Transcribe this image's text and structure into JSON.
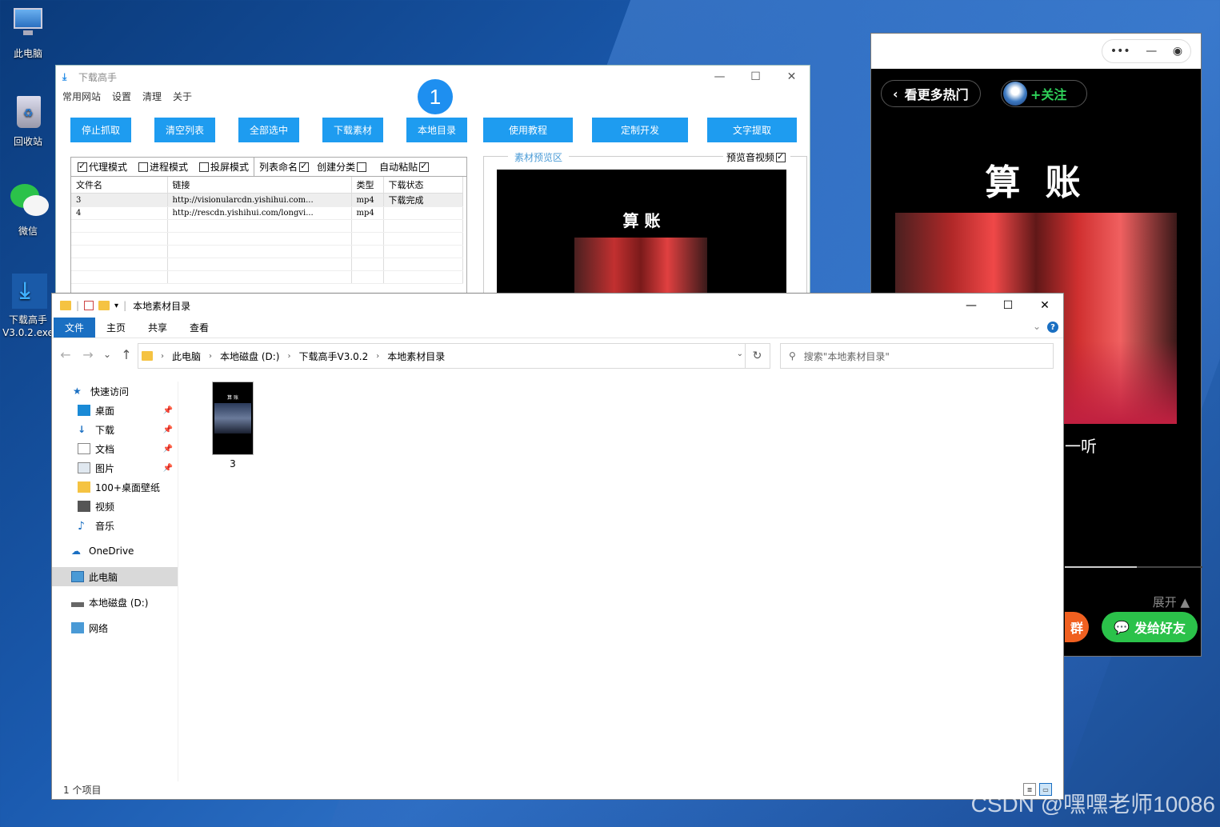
{
  "desktop": {
    "icons": [
      {
        "label": "此电脑"
      },
      {
        "label": "回收站"
      },
      {
        "label": "微信"
      },
      {
        "label": "下载高手\nV3.0.2.exe"
      }
    ]
  },
  "downloader": {
    "title": "下载高手",
    "menu": [
      "常用网站",
      "设置",
      "清理",
      "关于"
    ],
    "buttons": [
      "停止抓取",
      "清空列表",
      "全部选中",
      "下载素材",
      "本地目录",
      "使用教程",
      "定制开发",
      "文字提取"
    ],
    "badge": "1",
    "options": [
      {
        "label": "代理模式",
        "checked": true
      },
      {
        "label": "进程模式",
        "checked": false
      },
      {
        "label": "投屏模式",
        "checked": false
      },
      {
        "label": "列表命名",
        "checked": true
      },
      {
        "label": "创建分类",
        "checked": false
      },
      {
        "label": "自动粘贴",
        "checked": true
      }
    ],
    "table": {
      "headers": [
        "文件名",
        "链接",
        "类型",
        "下载状态"
      ],
      "rows": [
        [
          "3",
          "http://visionularcdn.yishihui.com...",
          "mp4",
          "下载完成"
        ],
        [
          "4",
          "http://rescdn.yishihui.com/longvi...",
          "mp4",
          ""
        ]
      ]
    },
    "preview": {
      "label": "素材预览区",
      "check_label": "预览音视频",
      "video_title": "算 账"
    }
  },
  "phone": {
    "back_label": "看更多热门",
    "follow_label": "+关注",
    "title": "算 账",
    "caption": "一听",
    "expand_label": "展开 ▲",
    "group_label": "群",
    "share_label": "发给好友"
  },
  "explorer": {
    "title": "本地素材目录",
    "tabs": [
      "文件",
      "主页",
      "共享",
      "查看"
    ],
    "breadcrumb": [
      "此电脑",
      "本地磁盘 (D:)",
      "下载高手V3.0.2",
      "本地素材目录"
    ],
    "search_placeholder": "搜索\"本地素材目录\"",
    "sidebar": [
      {
        "label": "快速访问",
        "pinned": false
      },
      {
        "label": "桌面",
        "pinned": true
      },
      {
        "label": "下载",
        "pinned": true
      },
      {
        "label": "文档",
        "pinned": true
      },
      {
        "label": "图片",
        "pinned": true
      },
      {
        "label": "100+桌面壁纸",
        "pinned": false
      },
      {
        "label": "视频",
        "pinned": false
      },
      {
        "label": "音乐",
        "pinned": false
      },
      {
        "label": "OneDrive",
        "pinned": false
      },
      {
        "label": "此电脑",
        "pinned": false
      },
      {
        "label": "本地磁盘 (D:)",
        "pinned": false
      },
      {
        "label": "网络",
        "pinned": false
      }
    ],
    "files": [
      {
        "name": "3",
        "thumb_title": "算 账"
      }
    ],
    "status": "1 个项目"
  },
  "watermark": "CSDN @嘿嘿老师10086",
  "colors": {
    "accent": "#1e9cf0",
    "explorer_blue": "#1a6fc2",
    "share_green": "#2bc24a"
  }
}
